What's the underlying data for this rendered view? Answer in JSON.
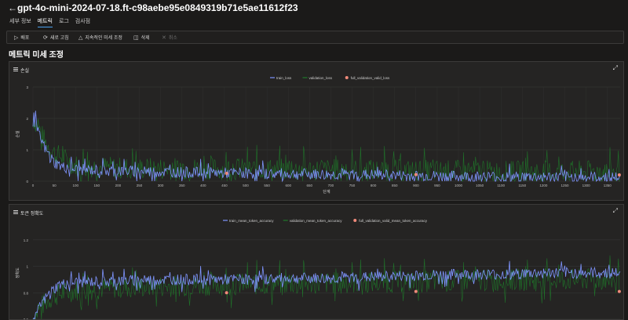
{
  "header": {
    "back_icon": "back-arrow-icon",
    "title": "gpt-4o-mini-2024-07-18.ft-c98aebe95e0849319b71e5ae11612f23"
  },
  "tabs": [
    {
      "label": "세부 정보",
      "active": false
    },
    {
      "label": "메트릭",
      "active": true
    },
    {
      "label": "로그",
      "active": false
    },
    {
      "label": "검사점",
      "active": false
    }
  ],
  "toolbar": {
    "deploy": {
      "label": "배포",
      "icon": "play-icon"
    },
    "refresh": {
      "label": "새로 고침",
      "icon": "refresh-icon"
    },
    "continuous": {
      "label": "지속적인 미세 조정",
      "icon": "flask-icon"
    },
    "delete": {
      "label": "삭제",
      "icon": "trash-icon"
    },
    "cancel": {
      "label": "취소",
      "icon": "close-icon",
      "disabled": true
    }
  },
  "section_title": "메트릭 미세 조정",
  "colors": {
    "train": "#7f95ff",
    "validation": "#1f7a2a",
    "full_valid": "#f08a7a",
    "accent": "#4aa0f0"
  },
  "chart_data": [
    {
      "type": "line",
      "title": "손실",
      "xlabel": "단계",
      "ylabel": "손실",
      "xlim": [
        0,
        1380
      ],
      "ylim": [
        0,
        3
      ],
      "xticks": [
        0,
        50,
        100,
        150,
        200,
        250,
        300,
        350,
        400,
        450,
        500,
        550,
        600,
        650,
        700,
        750,
        800,
        850,
        900,
        950,
        1000,
        1050,
        1100,
        1150,
        1200,
        1250,
        1300,
        1350
      ],
      "yticks": [
        0,
        1,
        2,
        3
      ],
      "legend_position": "top-center",
      "series": [
        {
          "name": "train_loss",
          "kind": "line",
          "points": [
            [
              0,
              1.9
            ],
            [
              5,
              2.2
            ],
            [
              10,
              1.6
            ],
            [
              20,
              1.3
            ],
            [
              30,
              1.0
            ],
            [
              40,
              0.8
            ],
            [
              50,
              0.6
            ],
            [
              70,
              0.45
            ],
            [
              100,
              0.38
            ],
            [
              150,
              0.35
            ],
            [
              200,
              0.33
            ],
            [
              300,
              0.3
            ],
            [
              400,
              0.27
            ],
            [
              500,
              0.25
            ],
            [
              600,
              0.23
            ],
            [
              700,
              0.21
            ],
            [
              800,
              0.2
            ],
            [
              900,
              0.17
            ],
            [
              1000,
              0.15
            ],
            [
              1100,
              0.14
            ],
            [
              1200,
              0.13
            ],
            [
              1300,
              0.12
            ],
            [
              1380,
              0.12
            ]
          ]
        },
        {
          "name": "validation_loss",
          "kind": "line",
          "points": [
            [
              0,
              2.0
            ],
            [
              10,
              1.8
            ],
            [
              30,
              1.2
            ],
            [
              50,
              0.9
            ],
            [
              100,
              0.5
            ],
            [
              200,
              0.42
            ],
            [
              300,
              0.4
            ],
            [
              400,
              0.4
            ],
            [
              500,
              0.38
            ],
            [
              600,
              0.37
            ],
            [
              700,
              0.36
            ],
            [
              800,
              0.35
            ],
            [
              900,
              0.33
            ],
            [
              1000,
              0.32
            ],
            [
              1100,
              0.3
            ],
            [
              1200,
              0.3
            ],
            [
              1380,
              0.3
            ]
          ]
        },
        {
          "name": "full_validation_valid_loss",
          "kind": "points",
          "points": [
            [
              455,
              0.25
            ],
            [
              900,
              0.21
            ],
            [
              1378,
              0.2
            ]
          ]
        }
      ]
    },
    {
      "type": "line",
      "title": "토큰 정확도",
      "xlabel": "",
      "ylabel": "정확도",
      "xlim": [
        0,
        1380
      ],
      "ylim": [
        0.6,
        1.3
      ],
      "yticks": [
        0.6,
        0.8,
        1,
        1.2
      ],
      "legend_position": "top-center",
      "series": [
        {
          "name": "train_mean_token_accuracy",
          "kind": "line",
          "points": [
            [
              0,
              0.55
            ],
            [
              10,
              0.65
            ],
            [
              20,
              0.72
            ],
            [
              40,
              0.8
            ],
            [
              60,
              0.86
            ],
            [
              100,
              0.88
            ],
            [
              200,
              0.89
            ],
            [
              300,
              0.9
            ],
            [
              400,
              0.9
            ],
            [
              500,
              0.9
            ],
            [
              600,
              0.91
            ],
            [
              700,
              0.91
            ],
            [
              800,
              0.92
            ],
            [
              900,
              0.93
            ],
            [
              1000,
              0.94
            ],
            [
              1100,
              0.94
            ],
            [
              1200,
              0.95
            ],
            [
              1300,
              0.95
            ],
            [
              1380,
              0.95
            ]
          ]
        },
        {
          "name": "validation_mean_token_accuracy",
          "kind": "line",
          "points": [
            [
              0,
              0.6
            ],
            [
              20,
              0.7
            ],
            [
              50,
              0.78
            ],
            [
              100,
              0.82
            ],
            [
              200,
              0.84
            ],
            [
              400,
              0.86
            ],
            [
              600,
              0.87
            ],
            [
              800,
              0.88
            ],
            [
              1000,
              0.89
            ],
            [
              1200,
              0.9
            ],
            [
              1380,
              0.9
            ]
          ]
        },
        {
          "name": "full_validation_valid_mean_token_accuracy",
          "kind": "points",
          "points": [
            [
              455,
              0.8
            ],
            [
              900,
              0.81
            ],
            [
              1378,
              0.81
            ]
          ]
        }
      ]
    }
  ]
}
